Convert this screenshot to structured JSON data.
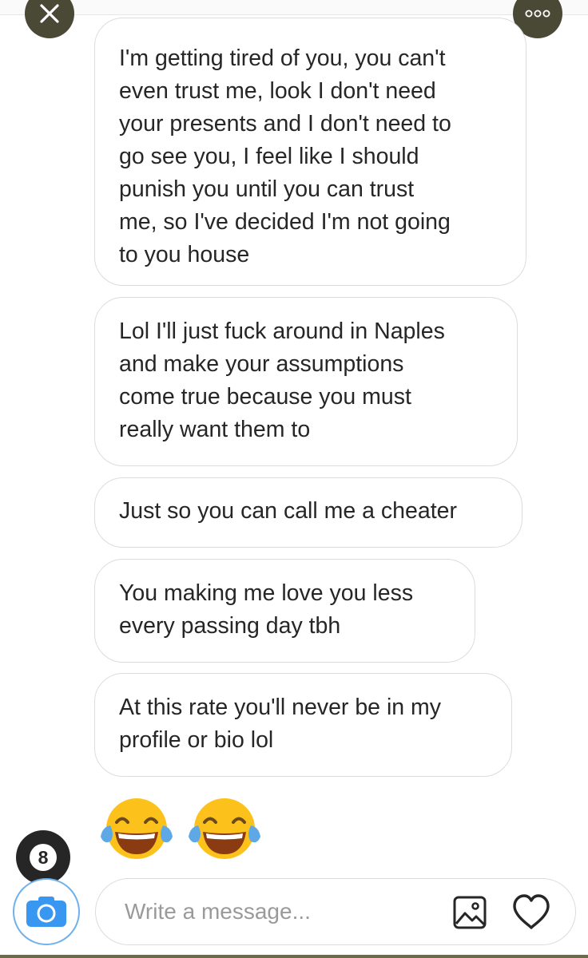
{
  "header": {
    "close_icon": "close-icon",
    "more_icon": "more-options-icon"
  },
  "messages": [
    {
      "text": "I'm getting tired of you, you can't\neven trust me, look I don't need\nyour presents and I don't need to\ngo see you, I feel like I should\npunish you until you can trust\nme, so I've decided I'm not going\nto you house"
    },
    {
      "text": "Lol I'll just fuck around in Naples\nand make your assumptions\ncome true because you must\nreally want them to"
    },
    {
      "text": "Just so you can call me a cheater"
    },
    {
      "text": "You making me love you less\nevery passing day tbh"
    },
    {
      "text": "At this rate you'll never be in my\nprofile or bio lol"
    }
  ],
  "emoji_message": {
    "emojis": [
      "face-with-tears-of-joy",
      "face-with-tears-of-joy"
    ]
  },
  "avatar_badge": {
    "label": "8"
  },
  "composer": {
    "placeholder": "Write a message...",
    "value": "",
    "camera_icon": "camera-icon",
    "gallery_icon": "gallery-icon",
    "like_icon": "heart-icon"
  },
  "colors": {
    "overlay_buttons": "#4a4936",
    "bubble_border": "#dcdcdc",
    "text": "#262626",
    "camera_blue": "#3897f0",
    "placeholder": "#9a9a9a"
  }
}
